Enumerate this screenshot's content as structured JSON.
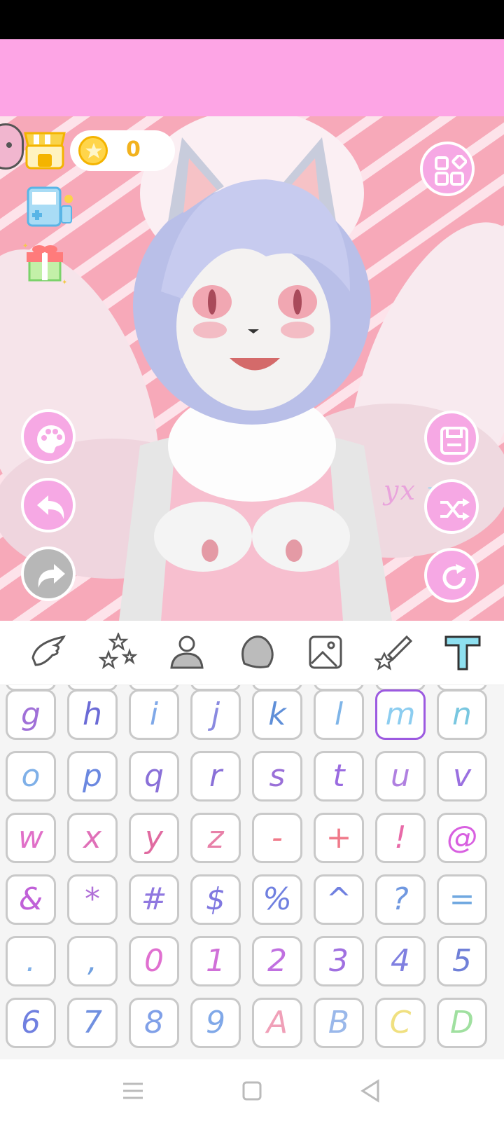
{
  "coins": {
    "count": "0"
  },
  "watermark": {
    "text_main": "yx",
    "text_accent": "m"
  },
  "left_icons": [
    "shop-icon",
    "arcade-machine-icon",
    "gift-icon"
  ],
  "right_buttons": [
    "categories-grid-icon",
    "save-icon",
    "shuffle-icon",
    "reset-icon"
  ],
  "left_buttons": [
    "palette-icon",
    "undo-icon",
    "redo-icon"
  ],
  "toolbar": {
    "tools": [
      "wings-icon",
      "stars-icon",
      "person-icon",
      "head-icon",
      "image-icon",
      "wand-icon",
      "text-icon"
    ],
    "active": "text-icon"
  },
  "keyboard": {
    "rows": [
      [
        "g",
        "h",
        "i",
        "j",
        "k",
        "l",
        "m",
        "n"
      ],
      [
        "o",
        "p",
        "q",
        "r",
        "s",
        "t",
        "u",
        "v"
      ],
      [
        "w",
        "x",
        "y",
        "z",
        "-",
        "+",
        "!",
        "@"
      ],
      [
        "&",
        "*",
        "#",
        "$",
        "%",
        "^",
        "?",
        "="
      ],
      [
        ".",
        ",",
        "0",
        "1",
        "2",
        "3",
        "4",
        "5"
      ],
      [
        "6",
        "7",
        "8",
        "9",
        "A",
        "B",
        "C",
        "D"
      ]
    ],
    "colors": [
      [
        "#a070d8",
        "#6b6bd6",
        "#7fa8e8",
        "#8a8ae0",
        "#5f8fd8",
        "#7fb5e8",
        "#8ccdf0",
        "#79c7e0"
      ],
      [
        "#7fb0e8",
        "#6b88e0",
        "#8a70d8",
        "#8a70d8",
        "#9a70d8",
        "#9a6be0",
        "#b080e0",
        "#9a70e0"
      ],
      [
        "#e070c8",
        "#e070b8",
        "#e06aa0",
        "#e880a8",
        "#f07a8a",
        "#f07a8a",
        "#e86aa8",
        "#d860e0"
      ],
      [
        "#c060d8",
        "#b070d8",
        "#9078e0",
        "#8078e0",
        "#7080e0",
        "#7080e0",
        "#7098e0",
        "#70a8e0"
      ],
      [
        "#80b0e8",
        "#70a0e0",
        "#e070d0",
        "#d070d8",
        "#c070e0",
        "#a070e0",
        "#8080e0",
        "#7080d8"
      ],
      [
        "#7080e0",
        "#7090e0",
        "#80a0e8",
        "#80a8e8",
        "#f0a0b8",
        "#9ab8ea",
        "#f0e080",
        "#a0e0a0"
      ]
    ],
    "selected": "m"
  },
  "nav": [
    "menu-icon",
    "home-icon",
    "back-icon"
  ]
}
